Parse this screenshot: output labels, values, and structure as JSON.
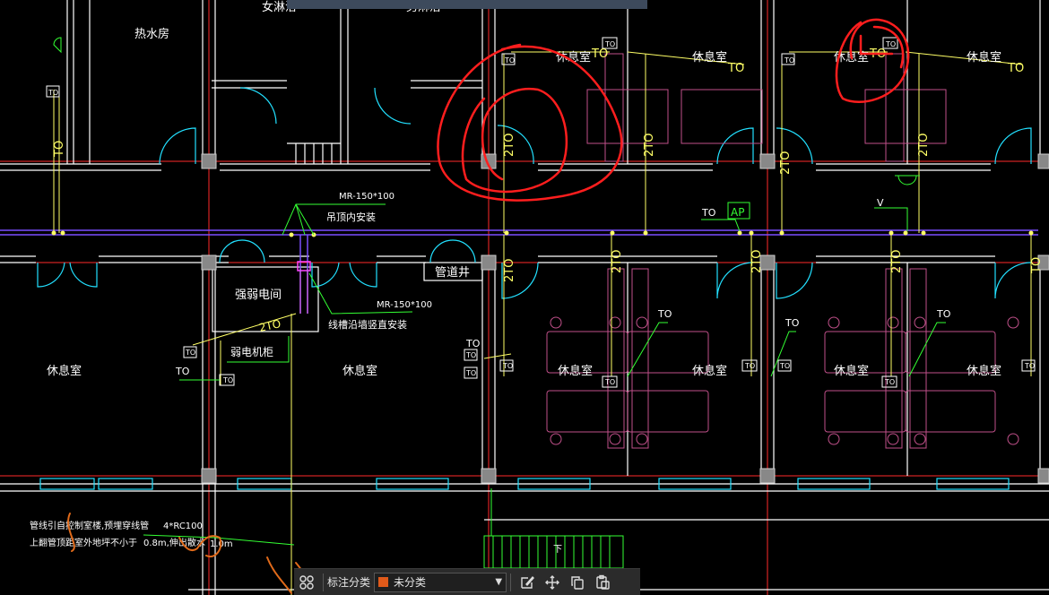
{
  "drawing": {
    "room_hot_water": "热水房",
    "room_female_shower": "女淋浴",
    "room_male_shower": "男淋浴",
    "room_rest": "休息室",
    "room_power_weak": "强弱电间",
    "room_pipe_shaft": "管道井",
    "cabinet_label": "弱电机柜",
    "tag_to": "TO",
    "tag_2to": "2TO",
    "tag_v": "V",
    "tag_ap": "AP",
    "note_mr1": "MR-150*100",
    "note_ceiling": "吊顶内安装",
    "note_mr2": "MR-150*100",
    "note_wall_trunk": "线槽沿墙竖直安装",
    "note_bottom_1": "管线引自控制室楼,预埋穿线管",
    "note_bottom_1b": "4*RC100",
    "note_bottom_2": "上翻管顶距室外地坪不小于",
    "note_bottom_2b": "0.8m,伸出散水",
    "note_bottom_2c": "1.0m",
    "stair_down": "下"
  },
  "toolbar": {
    "category_label": "标注分类",
    "category_value": "未分类",
    "category_color": "#e05a1a",
    "icons": [
      "grid-icon",
      "edit-icon",
      "move-icon",
      "copy-icon",
      "paste-icon"
    ]
  },
  "colors": {
    "wall": "#ffffff",
    "axis": "#ff2a2a",
    "door": "#22e0ff",
    "wire": "#ffff66",
    "tray": "#7a4dff",
    "furniture": "#c0508a",
    "leader": "#33ff33",
    "annotation": "#ff1e1e"
  }
}
